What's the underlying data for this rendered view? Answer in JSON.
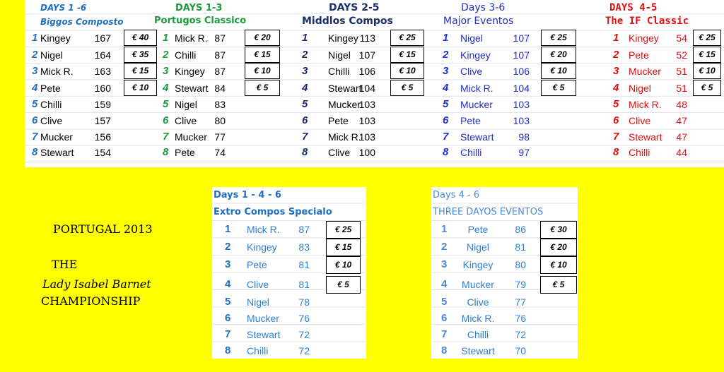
{
  "tables": [
    {
      "id": "biggos-composto",
      "line1": "DAYS 1 -6",
      "line2": "Biggos Composto",
      "color": "#1f6fc0",
      "rank_color": "#1f6fc0",
      "name_color": "#000000",
      "rows": [
        {
          "rank": "1",
          "name": "Kingey",
          "score": "167",
          "prize": "€ 40"
        },
        {
          "rank": "2",
          "name": "Nigel",
          "score": "164",
          "prize": "€ 35"
        },
        {
          "rank": "3",
          "name": "Mick R.",
          "score": "163",
          "prize": "€ 15"
        },
        {
          "rank": "4",
          "name": "Pete",
          "score": "160",
          "prize": "€ 10"
        },
        {
          "rank": "5",
          "name": "Chilli",
          "score": "159"
        },
        {
          "rank": "6",
          "name": "Clive",
          "score": "157"
        },
        {
          "rank": "7",
          "name": "Mucker",
          "score": "156"
        },
        {
          "rank": "8",
          "name": "Stewart",
          "score": "154"
        }
      ]
    },
    {
      "id": "portugos-classico",
      "line1": "DAYS 1-3",
      "line2": "Portugos Classico",
      "color": "#1a9a3a",
      "rank_color": "#1a9a3a",
      "name_color": "#000000",
      "rows": [
        {
          "rank": "1",
          "name": "Mick R.",
          "score": "87",
          "prize": "€ 20"
        },
        {
          "rank": "2",
          "name": "Chilli",
          "score": "87",
          "prize": "€ 15"
        },
        {
          "rank": "3",
          "name": "Kingey",
          "score": "87",
          "prize": "€ 10"
        },
        {
          "rank": "4",
          "name": "Stewart",
          "score": "84",
          "prize": "€ 5"
        },
        {
          "rank": "5",
          "name": "Nigel",
          "score": "83"
        },
        {
          "rank": "6",
          "name": "Clive",
          "score": "80"
        },
        {
          "rank": "7",
          "name": "Mucker",
          "score": "77"
        },
        {
          "rank": "8",
          "name": "Pete",
          "score": "74"
        }
      ]
    },
    {
      "id": "middlos-compos",
      "line1": "DAYS 2-5",
      "line2": "Middlos Compos",
      "color": "#1a2f6a",
      "rank_color": "#1a2f6a",
      "name_color": "#000000",
      "rows": [
        {
          "rank": "1",
          "name": "Kingey",
          "score": "113",
          "prize": "€ 25"
        },
        {
          "rank": "2",
          "name": "Nigel",
          "score": "107",
          "prize": "€ 15"
        },
        {
          "rank": "3",
          "name": "Chilli",
          "score": "106",
          "prize": "€ 10"
        },
        {
          "rank": "4",
          "name": "Stewart",
          "score": "104",
          "prize": "€ 5"
        },
        {
          "rank": "5",
          "name": "Mucker",
          "score": "103"
        },
        {
          "rank": "6",
          "name": "Pete",
          "score": "103"
        },
        {
          "rank": "7",
          "name": "Mick R.",
          "score": "103"
        },
        {
          "rank": "8",
          "name": "Clive",
          "score": "100"
        }
      ]
    },
    {
      "id": "major-eventos",
      "line1": "Days 3-6",
      "line2": "Major Eventos",
      "color": "#1f2fc8",
      "rank_color": "#1f2fc8",
      "name_color": "#1f2fc8",
      "rows": [
        {
          "rank": "1",
          "name": "Nigel",
          "score": "107",
          "prize": "€ 25"
        },
        {
          "rank": "2",
          "name": "Kingey",
          "score": "107",
          "prize": "€ 20"
        },
        {
          "rank": "3",
          "name": "Clive",
          "score": "106",
          "prize": "€ 10"
        },
        {
          "rank": "4",
          "name": "Mick R.",
          "score": "104",
          "prize": "€ 5"
        },
        {
          "rank": "5",
          "name": "Mucker",
          "score": "103"
        },
        {
          "rank": "6",
          "name": "Pete",
          "score": "103"
        },
        {
          "rank": "7",
          "name": "Stewart",
          "score": "98"
        },
        {
          "rank": "8",
          "name": "Chilli",
          "score": "97"
        }
      ]
    },
    {
      "id": "if-classic",
      "line1": "DAYS 4-5",
      "line2": "The IF Classic",
      "color": "#e01010",
      "rank_color": "#e01010",
      "name_color": "#e01010",
      "rows": [
        {
          "rank": "1",
          "name": "Kingey",
          "score": "54",
          "prize": "€ 25"
        },
        {
          "rank": "2",
          "name": "Pete",
          "score": "52",
          "prize": "€ 15"
        },
        {
          "rank": "3",
          "name": "Mucker",
          "score": "51",
          "prize": "€ 10"
        },
        {
          "rank": "4",
          "name": "Nigel",
          "score": "51",
          "prize": "€ 5"
        },
        {
          "rank": "5",
          "name": "Mick R.",
          "score": "48"
        },
        {
          "rank": "6",
          "name": "Clive",
          "score": "47"
        },
        {
          "rank": "7",
          "name": "Stewart",
          "score": "47"
        },
        {
          "rank": "8",
          "name": "Chilli",
          "score": "44"
        }
      ]
    },
    {
      "id": "extro-compos-specialo",
      "line1": "Days 1 - 4 - 6",
      "line2": "Extro Compos Specialo",
      "color": "#1f6fc0",
      "rank_color": "#1f6fc0",
      "name_color": "#2e7fcf",
      "rows": [
        {
          "rank": "1",
          "name": "Mick R.",
          "score": "87",
          "prize": "€ 25"
        },
        {
          "rank": "2",
          "name": "Kingey",
          "score": "83",
          "prize": "€ 15"
        },
        {
          "rank": "3",
          "name": "Pete",
          "score": "81",
          "prize": "€ 10"
        },
        {
          "rank": "4",
          "name": "Clive",
          "score": "81",
          "prize": "€ 5"
        },
        {
          "rank": "5",
          "name": "Nigel",
          "score": "78"
        },
        {
          "rank": "6",
          "name": "Mucker",
          "score": "76"
        },
        {
          "rank": "7",
          "name": "Stewart",
          "score": "72"
        },
        {
          "rank": "8",
          "name": "Chilli",
          "score": "72"
        }
      ]
    },
    {
      "id": "three-dayos-eventos",
      "line1": "Days 4 - 6",
      "line2": "THREE DAYOS EVENTOS",
      "color": "#4a8ad8",
      "rank_color": "#4a8ad8",
      "name_color": "#2e7fcf",
      "rows": [
        {
          "rank": "1",
          "name": "Pete",
          "score": "86",
          "prize": "€ 30"
        },
        {
          "rank": "2",
          "name": "Nigel",
          "score": "81",
          "prize": "€ 20"
        },
        {
          "rank": "3",
          "name": "Kingey",
          "score": "80",
          "prize": "€ 10"
        },
        {
          "rank": "4",
          "name": "Mucker",
          "score": "79",
          "prize": "€ 5"
        },
        {
          "rank": "5",
          "name": "Clive",
          "score": "77"
        },
        {
          "rank": "6",
          "name": "Mick R.",
          "score": "76"
        },
        {
          "rank": "7",
          "name": "Chilli",
          "score": "72"
        },
        {
          "rank": "8",
          "name": "Stewart",
          "score": "70"
        }
      ]
    }
  ],
  "championship": {
    "line1": "PORTUGAL 2013",
    "line2": "THE",
    "line3": "Lady Isabel Barnet",
    "line4": "CHAMPIONSHIP"
  },
  "colors": {
    "background": "#ffff00",
    "sheet": "#ffffff",
    "prize_border": "#000000"
  }
}
